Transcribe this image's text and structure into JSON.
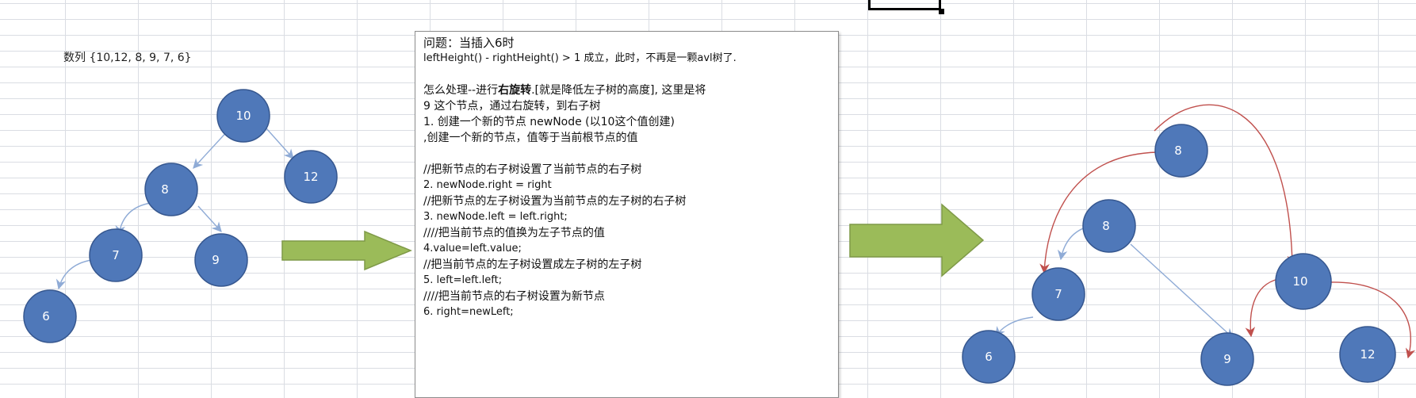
{
  "sequence_label": "数列 {10,12, 8, 9, 7, 6}",
  "colors": {
    "node_fill": "#4f78b9",
    "node_edge_blue": "#8fabd6",
    "node_edge_red": "#c0504d",
    "arrow_green": "#9bbb59"
  },
  "notes": {
    "line1": "问题：当插入6时",
    "line2": "leftHeight() - rightHeight() > 1 成立，此时，不再是一颗avl树了.",
    "line3": "",
    "line4_pre": "怎么处理--进行",
    "line4_bold": "右旋转",
    "line4_post": ".[就是降低左子树的高度], 这里是将",
    "line5": "9 这个节点，通过右旋转，到右子树",
    "line6": "1. 创建一个新的节点 newNode (以10这个值创建)",
    "line7": ",创建一个新的节点，值等于当前根节点的值",
    "line8": "",
    "line9": "//把新节点的右子树设置了当前节点的右子树",
    "line10": "2. newNode.right = right",
    "line11": "//把新节点的左子树设置为当前节点的左子树的右子树",
    "line12": "3. newNode.left = left.right;",
    "line13": "////把当前节点的值换为左子节点的值",
    "line14": "4.value=left.value;",
    "line15": "//把当前节点的左子树设置成左子树的左子树",
    "line16": "5. left=left.left;",
    "line17": "////把当前节点的右子树设置为新节点",
    "line18": "6. right=newLeft;"
  },
  "left_tree": {
    "nodes": [
      "10",
      "12",
      "8",
      "7",
      "9",
      "6"
    ]
  },
  "right_tree": {
    "nodes": [
      "8",
      "8",
      "10",
      "7",
      "6",
      "9",
      "12"
    ]
  }
}
